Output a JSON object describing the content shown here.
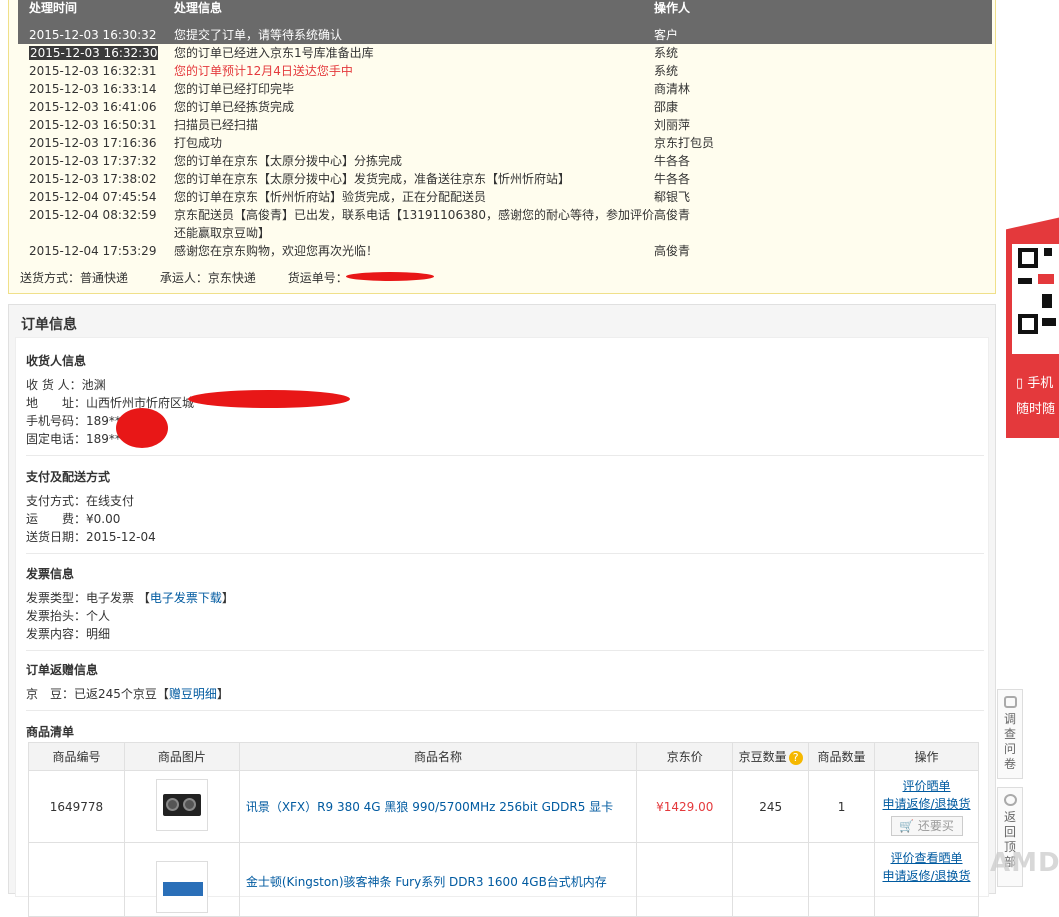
{
  "tracking": {
    "headers": {
      "time": "处理时间",
      "info": "处理信息",
      "operator": "操作人"
    },
    "rows": [
      {
        "time": "2015-12-03 16:30:32",
        "info": "您提交了订单，请等待系统确认",
        "operator": "客户"
      },
      {
        "time": "2015-12-03 16:32:30",
        "info": "您的订单已经进入京东1号库准备出库",
        "operator": "系统"
      },
      {
        "time": "2015-12-03 16:32:31",
        "info": "您的订单预计12月4日送达您手中",
        "operator": "系统"
      },
      {
        "time": "2015-12-03 16:33:14",
        "info": "您的订单已经打印完毕",
        "operator": "商清林"
      },
      {
        "time": "2015-12-03 16:41:06",
        "info": "您的订单已经拣货完成",
        "operator": "邵康"
      },
      {
        "time": "2015-12-03 16:50:31",
        "info": "扫描员已经扫描",
        "operator": "刘丽萍"
      },
      {
        "time": "2015-12-03 17:16:36",
        "info": "打包成功",
        "operator": "京东打包员"
      },
      {
        "time": "2015-12-03 17:37:32",
        "info": "您的订单在京东【太原分拨中心】分拣完成",
        "operator": "牛各各"
      },
      {
        "time": "2015-12-03 17:38:02",
        "info": "您的订单在京东【太原分拨中心】发货完成，准备送往京东【忻州忻府站】",
        "operator": "牛各各"
      },
      {
        "time": "2015-12-04 07:45:54",
        "info": "您的订单在京东【忻州忻府站】验货完成，正在分配配送员",
        "operator": "郗银飞"
      },
      {
        "time": "2015-12-04 08:32:59",
        "info": "京东配送员【高俊青】已出发，联系电话【13191106380，感谢您的耐心等待，参加评价",
        "info2": "还能赢取京豆呦】",
        "operator": "高俊青"
      },
      {
        "time": "2015-12-04 17:53:29",
        "info": "感谢您在京东购物，欢迎您再次光临！",
        "operator": "高俊青"
      }
    ],
    "shipping": {
      "method": "送货方式：普通快递",
      "carrier": "承运人：京东快递",
      "waybill": "货运单号："
    }
  },
  "order": {
    "title": "订单信息",
    "receiver": {
      "title": "收货人信息",
      "name": "收 货 人：池渊",
      "address": "地　　址：山西忻州市忻府区城",
      "mobile": "手机号码：189****",
      "phone": "固定电话：189****"
    },
    "payment": {
      "title": "支付及配送方式",
      "method": "支付方式：在线支付",
      "freight": "运　　费：¥0.00",
      "date": "送货日期：2015-12-04"
    },
    "invoice": {
      "title": "发票信息",
      "type_prefix": "发票类型：电子发票 【",
      "type_link": "电子发票下载",
      "type_suffix": "】",
      "head": "发票抬头：个人",
      "content": "发票内容：明细"
    },
    "rebate": {
      "title": "订单返赠信息",
      "beans_prefix": "京　豆：已返245个京豆【",
      "beans_link": "赠豆明细",
      "beans_suffix": "】"
    },
    "goods": {
      "title": "商品清单",
      "headers": {
        "id": "商品编号",
        "img": "商品图片",
        "name": "商品名称",
        "price": "京东价",
        "beans": "京豆数量",
        "qty": "商品数量",
        "ops": "操作"
      },
      "items": [
        {
          "id": "1649778",
          "name": "讯景（XFX）R9 380 4G 黑狼 990/5700MHz 256bit GDDR5 显卡",
          "price": "¥1429.00",
          "beans": "245",
          "qty": "1",
          "op1": "评价晒单",
          "op2": "申请返修/退换货",
          "op3": "还要买"
        },
        {
          "id": "",
          "name": "金士顿(Kingston)骇客神条 Fury系列 DDR3 1600 4GB台式机内存",
          "price": "",
          "beans": "",
          "qty": "",
          "op1": "评价查看晒单",
          "op2": "申请返修/退换货",
          "op3": ""
        }
      ]
    }
  },
  "side": {
    "promo1": "手机",
    "promo2": "随时随",
    "survey": "调查问卷",
    "backtop": "返回顶部"
  },
  "watermark": "AMD"
}
